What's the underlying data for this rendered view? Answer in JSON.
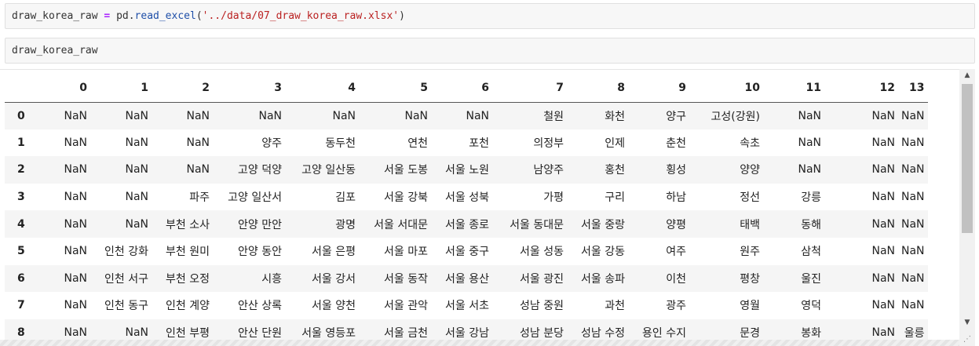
{
  "cells": [
    {
      "tokens": {
        "var": "draw_korea_raw",
        "op": " = ",
        "mod": "pd.",
        "fn": "read_excel",
        "open": "(",
        "arg": "'../data/07_draw_korea_raw.xlsx'",
        "close": ")"
      }
    },
    {
      "code": "draw_korea_raw"
    }
  ],
  "dataframe": {
    "columns": [
      "",
      "0",
      "1",
      "2",
      "3",
      "4",
      "5",
      "6",
      "7",
      "8",
      "9",
      "10",
      "11",
      "12",
      "13"
    ],
    "rows": [
      {
        "index": "0",
        "values": [
          "NaN",
          "NaN",
          "NaN",
          "NaN",
          "NaN",
          "NaN",
          "NaN",
          "철원",
          "화천",
          "양구",
          "고성(강원)",
          "NaN",
          "NaN",
          "NaN"
        ]
      },
      {
        "index": "1",
        "values": [
          "NaN",
          "NaN",
          "NaN",
          "양주",
          "동두천",
          "연천",
          "포천",
          "의정부",
          "인제",
          "춘천",
          "속초",
          "NaN",
          "NaN",
          "NaN"
        ]
      },
      {
        "index": "2",
        "values": [
          "NaN",
          "NaN",
          "NaN",
          "고양 덕양",
          "고양 일산동",
          "서울 도봉",
          "서울 노원",
          "남양주",
          "홍천",
          "횡성",
          "양양",
          "NaN",
          "NaN",
          "NaN"
        ]
      },
      {
        "index": "3",
        "values": [
          "NaN",
          "NaN",
          "파주",
          "고양 일산서",
          "김포",
          "서울 강북",
          "서울 성북",
          "가평",
          "구리",
          "하남",
          "정선",
          "강릉",
          "NaN",
          "NaN"
        ]
      },
      {
        "index": "4",
        "values": [
          "NaN",
          "NaN",
          "부천 소사",
          "안양 만안",
          "광명",
          "서울 서대문",
          "서울 종로",
          "서울 동대문",
          "서울 중랑",
          "양평",
          "태백",
          "동해",
          "NaN",
          "NaN"
        ]
      },
      {
        "index": "5",
        "values": [
          "NaN",
          "인천 강화",
          "부천 원미",
          "안양 동안",
          "서울 은평",
          "서울 마포",
          "서울 중구",
          "서울 성동",
          "서울 강동",
          "여주",
          "원주",
          "삼척",
          "NaN",
          "NaN"
        ]
      },
      {
        "index": "6",
        "values": [
          "NaN",
          "인천 서구",
          "부천 오정",
          "시흥",
          "서울 강서",
          "서울 동작",
          "서울 용산",
          "서울 광진",
          "서울 송파",
          "이천",
          "평창",
          "울진",
          "NaN",
          "NaN"
        ]
      },
      {
        "index": "7",
        "values": [
          "NaN",
          "인천 동구",
          "인천 계양",
          "안산 상록",
          "서울 양천",
          "서울 관악",
          "서울 서초",
          "성남 중원",
          "과천",
          "광주",
          "영월",
          "영덕",
          "NaN",
          "NaN"
        ]
      },
      {
        "index": "8",
        "values": [
          "NaN",
          "NaN",
          "인천 부평",
          "안산 단원",
          "서울 영등포",
          "서울 금천",
          "서울 강남",
          "성남 분당",
          "성남 수정",
          "용인 수지",
          "문경",
          "봉화",
          "NaN",
          "울릉"
        ]
      }
    ]
  },
  "scrollbar": {
    "up_glyph": "▲",
    "down_glyph": "▼",
    "grip_glyph": "⋰"
  }
}
